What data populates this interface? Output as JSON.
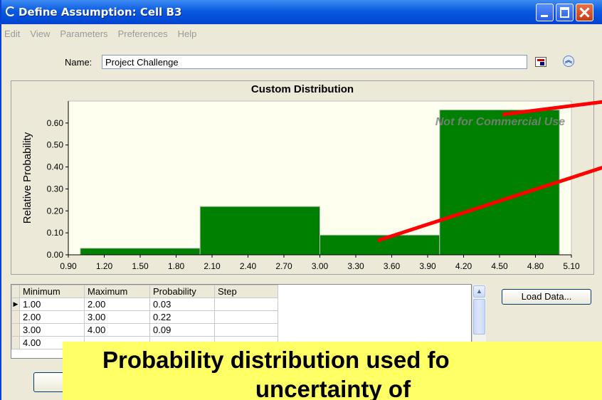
{
  "window": {
    "title": "Define Assumption: Cell B3"
  },
  "menu": [
    "Edit",
    "View",
    "Parameters",
    "Preferences",
    "Help"
  ],
  "name_field": {
    "label": "Name:",
    "value": "Project Challenge"
  },
  "chart_data": {
    "type": "bar",
    "title": "Custom Distribution",
    "ylabel": "Relative Probability",
    "xlabel": "",
    "watermark": "Not for Commercial Use",
    "bins": [
      {
        "min": 1.0,
        "max": 2.0,
        "probability": 0.03
      },
      {
        "min": 2.0,
        "max": 3.0,
        "probability": 0.22
      },
      {
        "min": 3.0,
        "max": 4.0,
        "probability": 0.09
      },
      {
        "min": 4.0,
        "max": 5.0,
        "probability": 0.66
      }
    ],
    "xlim": [
      0.9,
      5.1
    ],
    "ylim": [
      0,
      0.7
    ],
    "x_ticks": [
      "0.90",
      "1.20",
      "1.50",
      "1.80",
      "2.10",
      "2.40",
      "2.70",
      "3.00",
      "3.30",
      "3.60",
      "3.90",
      "4.20",
      "4.50",
      "4.80",
      "5.10"
    ],
    "y_ticks": [
      "0.00",
      "0.10",
      "0.20",
      "0.30",
      "0.40",
      "0.50",
      "0.60"
    ],
    "bar_color": "#008000",
    "plot_bg": "#fffff0",
    "grid": false
  },
  "table": {
    "columns": [
      "Minimum",
      "Maximum",
      "Probability",
      "Step"
    ],
    "rows": [
      [
        "1.00",
        "2.00",
        "0.03",
        ""
      ],
      [
        "2.00",
        "3.00",
        "0.22",
        ""
      ],
      [
        "3.00",
        "4.00",
        "0.09",
        ""
      ],
      [
        "4.00",
        "",
        "",
        ""
      ]
    ],
    "selected_row_marker": "▶"
  },
  "buttons": {
    "load_data": "Load Data..."
  },
  "caption": {
    "line1": "Probability distribution used fo",
    "line2": "uncertainty of"
  },
  "colors": {
    "titlebar": "#0a5ae0",
    "annotation_line": "#ff0000",
    "caption_bg": "#ffff66"
  }
}
